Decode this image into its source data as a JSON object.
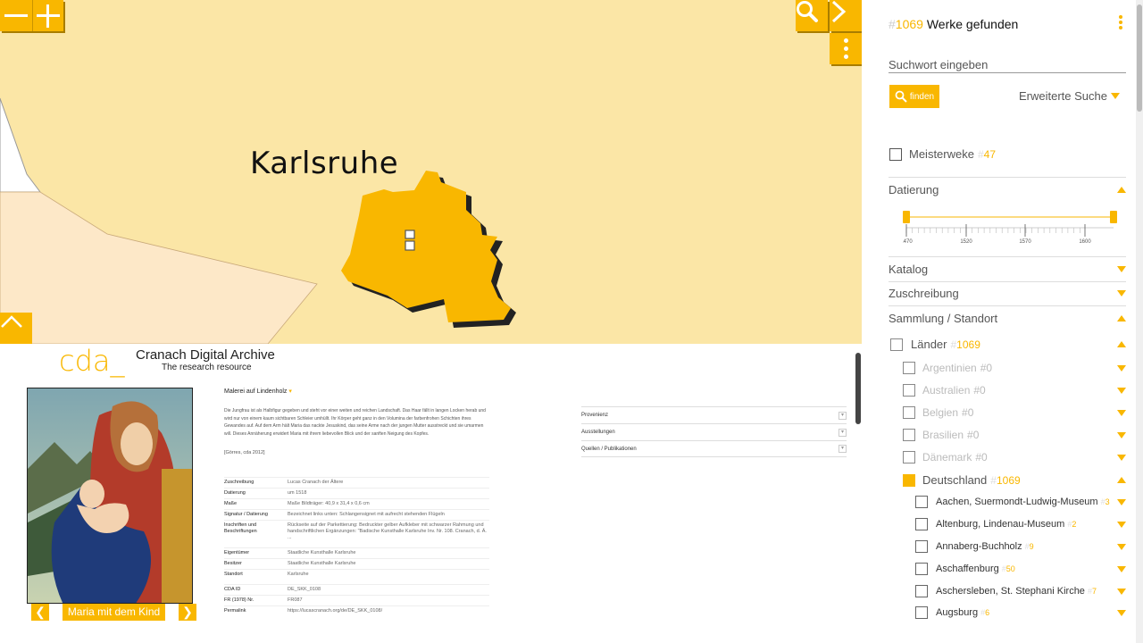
{
  "map": {
    "zoom_out_label": "−",
    "zoom_in_label": "+",
    "city_label": "Karlsruhe"
  },
  "cda": {
    "logo": "cda_",
    "title": "Cranach Digital Archive",
    "subtitle": "The research resource"
  },
  "artwork": {
    "title": "Maria mit dem Kind",
    "technique": "Malerei auf Lindenholz",
    "description": "Die Jungfrau ist als Halbfigur gegeben und steht vor einer weiten und reichen Landschaft. Das Haar fällt in langen Locken herab und wird nur von einem kaum sichtbaren Schleier umhüllt. Ihr Körper geht ganz in den Volumina der farbenfrohen Schichten ihres Gewandes auf. Auf dem Arm hält Maria das nackte Jesuskind, das seine Arme nach der jungen Mutter ausstreckt und sie umarmen will. Dieses Annäherung erwidert Maria mit ihrem liebevollen Blick und der sanften Neigung des Kopfes.",
    "citation": "[Görres, cda 2012]",
    "details": [
      {
        "k": "Zuschreibung",
        "v": "Lucas Cranach der Ältere"
      },
      {
        "k": "Datierung",
        "v": "um 1518"
      },
      {
        "k": "Maße",
        "v": "Maße Bildträger: 40,9 x 31,4 x 0,6 cm"
      },
      {
        "k": "Signatur / Datierung",
        "v": "Bezeichnet links unten: Schlangensignet mit aufrecht stehenden Flügeln"
      },
      {
        "k": "Inschriften und Beschriftungen",
        "v": "Rückseite auf der Parkettierung: Bedruckter gelber Aufkleber mit schwarzer Rahmung und handschriftlichen Ergänzungen: \"Badische Kunsthalle Karlsruhe Inv. Nr. 108. Cranach, d. Ä. ..."
      },
      {
        "k": "Eigentümer",
        "v": "Staatliche Kunsthalle Karlsruhe"
      },
      {
        "k": "Besitzer",
        "v": "Staatliche Kunsthalle Karlsruhe"
      },
      {
        "k": "Standort",
        "v": "Karlsruhe"
      },
      {
        "k": "CDA ID",
        "v": "DE_SKK_0108"
      },
      {
        "k": "FR (1978) Nr.",
        "v": "FR087"
      },
      {
        "k": "Permalink",
        "v": "https://lucascranach.org/de/DE_SKK_0108/"
      }
    ],
    "accordions": [
      "Provenienz",
      "Ausstellungen",
      "Quellen / Publikationen"
    ]
  },
  "sidebar": {
    "found_hash": "#",
    "found_count": "1069",
    "found_label": " Werke gefunden",
    "search_placeholder": "Suchwort eingeben",
    "find_label": "finden",
    "advanced_label": "Erweiterte Suche",
    "masterpieces": {
      "label": "Meisterweke",
      "hash": "#",
      "count": "47"
    },
    "dating": {
      "label": "Datierung",
      "ticks": [
        "1470",
        "1520",
        "1570",
        "1600"
      ]
    },
    "sections": [
      "Katalog",
      "Zuschreibung",
      "Sammlung / Standort"
    ],
    "countries": {
      "label": "Länder",
      "hash": "#",
      "count": "1069"
    },
    "country_items": [
      {
        "label": "Argentinien",
        "count": "#0"
      },
      {
        "label": "Australien",
        "count": "#0"
      },
      {
        "label": "Belgien",
        "count": "#0"
      },
      {
        "label": "Brasilien",
        "count": "#0"
      },
      {
        "label": "Dänemark",
        "count": "#0"
      }
    ],
    "germany": {
      "label": "Deutschland",
      "hash": "#",
      "count": "1069"
    },
    "cities": [
      {
        "label": "Aachen, Suermondt-Ludwig-Museum",
        "hash": "#",
        "count": "3"
      },
      {
        "label": "Altenburg, Lindenau-Museum",
        "hash": "#",
        "count": "2"
      },
      {
        "label": "Annaberg-Buchholz",
        "hash": "#",
        "count": "9"
      },
      {
        "label": "Aschaffenburg",
        "hash": "#",
        "count": "50"
      },
      {
        "label": "Aschersleben, St. Stephani Kirche",
        "hash": "#",
        "count": "7"
      },
      {
        "label": "Augsburg",
        "hash": "#",
        "count": "6"
      }
    ]
  },
  "colors": {
    "accent": "#f9b700",
    "map_bg": "#fbe6a6",
    "shadow": "#a87d00"
  }
}
